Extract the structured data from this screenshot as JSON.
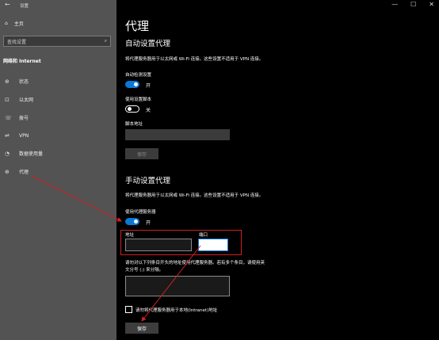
{
  "window": {
    "title": "设置",
    "back": "←",
    "controls": [
      "—",
      "☐",
      "✕"
    ]
  },
  "sidebar": {
    "home": "主页",
    "search_placeholder": "查找设置",
    "section": "网络和 Internet",
    "items": [
      {
        "label": "状态",
        "icon": "globe-status-icon"
      },
      {
        "label": "以太网",
        "icon": "ethernet-icon"
      },
      {
        "label": "拨号",
        "icon": "dialup-icon"
      },
      {
        "label": "VPN",
        "icon": "vpn-icon"
      },
      {
        "label": "数据使用量",
        "icon": "data-usage-icon"
      },
      {
        "label": "代理",
        "icon": "globe-icon"
      }
    ]
  },
  "main": {
    "title": "代理",
    "auto": {
      "heading": "自动设置代理",
      "desc": "将代理服务器用于以太网或 Wi-Fi 连接。这些设置不适用于 VPN 连接。",
      "detect_label": "自动检测设置",
      "detect_state": "开",
      "script_label": "使用设置脚本",
      "script_state": "关",
      "address_label": "脚本地址",
      "save": "保存"
    },
    "manual": {
      "heading": "手动设置代理",
      "desc": "将代理服务器用于以太网或 Wi-Fi 连接。这些设置不适用于 VPN 连接。",
      "use_label": "使用代理服务器",
      "use_state": "开",
      "address_label": "地址",
      "port_label": "端口",
      "address_value": "",
      "port_value": "",
      "exceptions_line1": "请勿对以下列条目开头的地址使用代理服务器。若有多个条目，请使用英",
      "exceptions_line2": "文分号 (;) 来分隔。",
      "local_checkbox": "请勿将代理服务器用于本地(Intranet)地址",
      "save": "保存"
    }
  },
  "annotation_color": "#d02020"
}
